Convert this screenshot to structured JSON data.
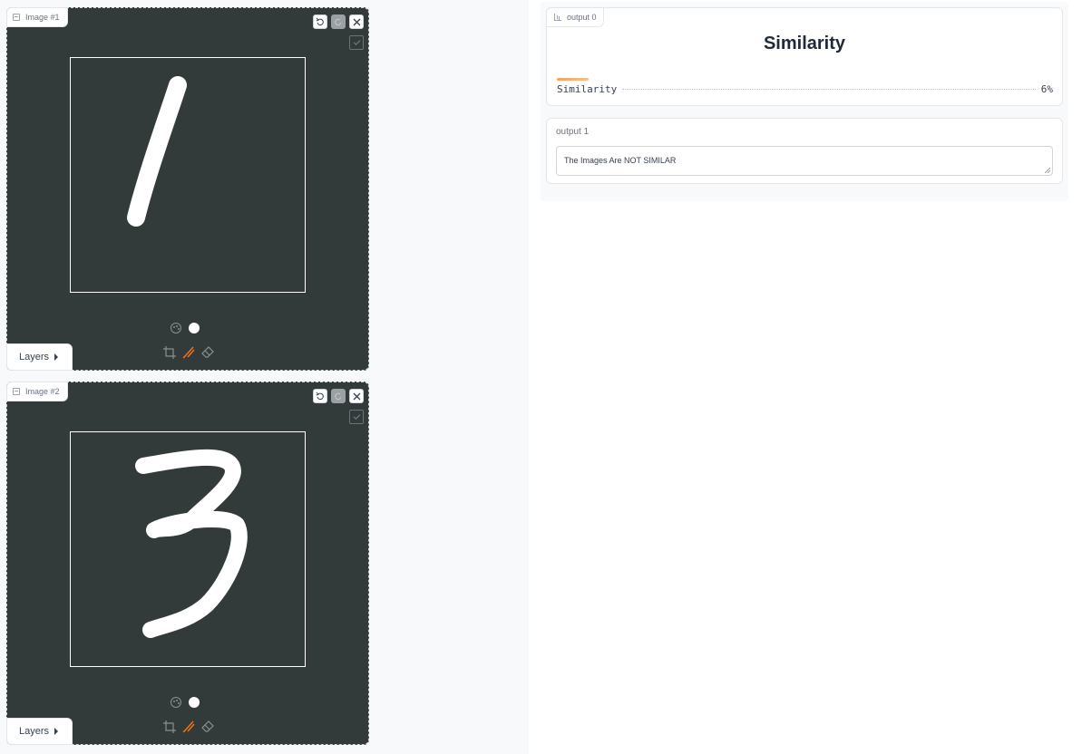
{
  "inputs": [
    {
      "label": "Image #1",
      "undo_icon": "undo-icon",
      "redo_icon": "redo-icon",
      "close_icon": "close-icon",
      "check_icon": "check-icon",
      "palette_icon": "palette-icon",
      "brush_color": "#ffffff",
      "tools": [
        "crop-icon",
        "brush-icon",
        "eraser-icon"
      ],
      "active_tool": "brush-icon",
      "layers_label": "Layers"
    },
    {
      "label": "Image #2",
      "undo_icon": "undo-icon",
      "redo_icon": "redo-icon",
      "close_icon": "close-icon",
      "check_icon": "check-icon",
      "palette_icon": "palette-icon",
      "brush_color": "#ffffff",
      "tools": [
        "crop-icon",
        "brush-icon",
        "eraser-icon"
      ],
      "active_tool": "brush-icon",
      "layers_label": "Layers"
    }
  ],
  "output0": {
    "label": "output 0",
    "title": "Similarity",
    "confidence_label": "Similarity",
    "confidence_value": "6%",
    "confidence_fraction": 0.06
  },
  "output1": {
    "label": "output 1",
    "text": "The Images Are NOT SIMILAR"
  },
  "colors": {
    "canvas_bg": "#323a3a",
    "accent": "#f97316",
    "stroke": "#ffffff"
  }
}
